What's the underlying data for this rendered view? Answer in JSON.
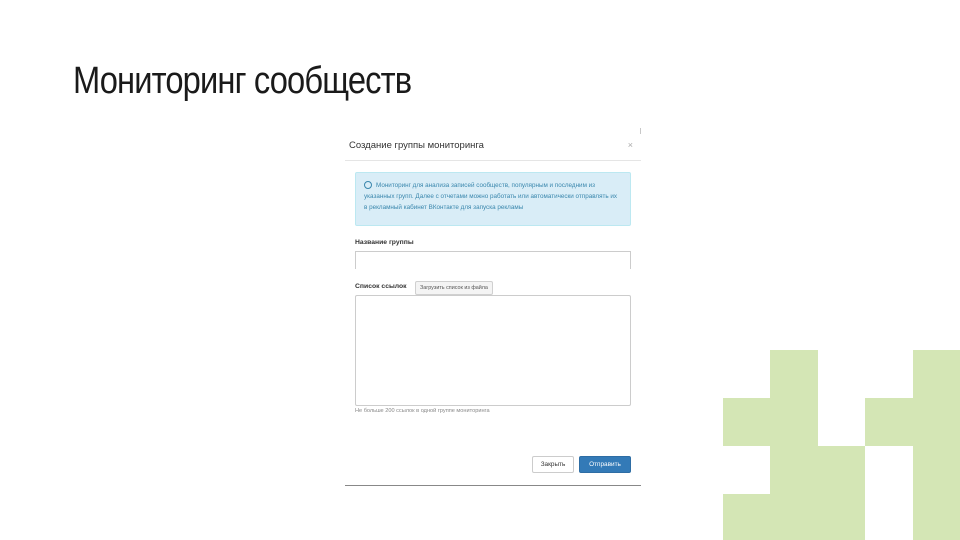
{
  "slide": {
    "title": "Мониторинг сообществ"
  },
  "modal": {
    "title": "Создание группы мониторинга",
    "close_icon": "close-icon",
    "info": {
      "icon": "info-icon",
      "text": "Мониторинг для анализа записей сообществ, популярным и последним из указанных групп. Далее с отчетами можно работать или автоматически отправлять их в рекламный кабинет ВКонтакте для запуска рекламы"
    },
    "group_name_label": "Название группы",
    "group_name_value": "",
    "links_label": "Список ссылок",
    "load_links_button": "Загрузить список из файла",
    "links_value": "",
    "help_text": "Не больше 200 ссылок в одной группе мониторинга",
    "close_button": "Закрыть",
    "submit_button": "Отправить"
  },
  "colors": {
    "deco_green": "#d4e6b5",
    "info_bg": "#d9edf7",
    "info_text": "#3a87ad",
    "primary_button": "#337ab7"
  }
}
